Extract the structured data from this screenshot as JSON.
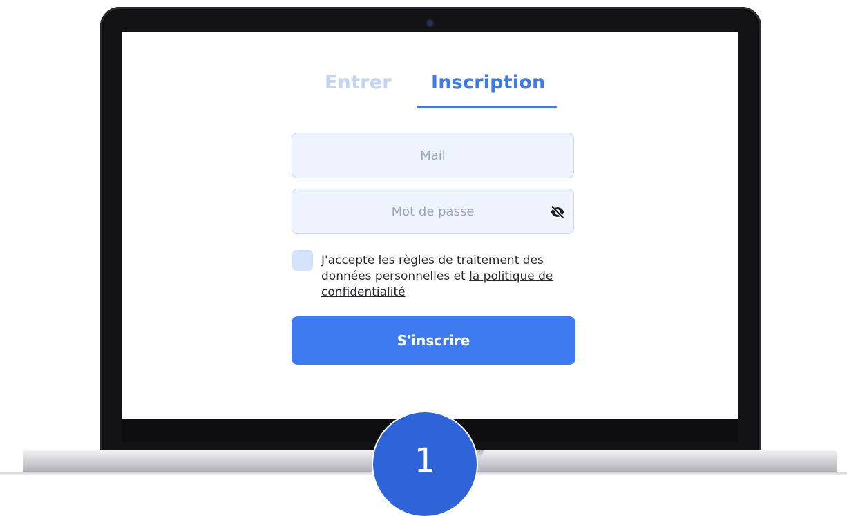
{
  "tabs": [
    {
      "label": "Entrer",
      "active": false
    },
    {
      "label": "Inscription",
      "active": true
    }
  ],
  "form": {
    "mail_placeholder": "Mail",
    "password_placeholder": "Mot de passe",
    "password_toggle_icon": "eye-slash-icon",
    "checkbox_checked": false,
    "consent": {
      "text_1": "J'accepte les ",
      "link_1": "règles",
      "text_2": " de traitement des données personnelles et ",
      "link_2": "la politique de confidentialité"
    },
    "submit_label": "S'inscrire"
  },
  "step_badge": "1",
  "colors": {
    "accent": "#3f7be8",
    "button": "#3f7bf0",
    "inactive_tab": "#c2d3f6",
    "field_bg": "#eef3fe",
    "checkbox_bg": "#d4e2fb",
    "badge": "#2f63d8"
  }
}
